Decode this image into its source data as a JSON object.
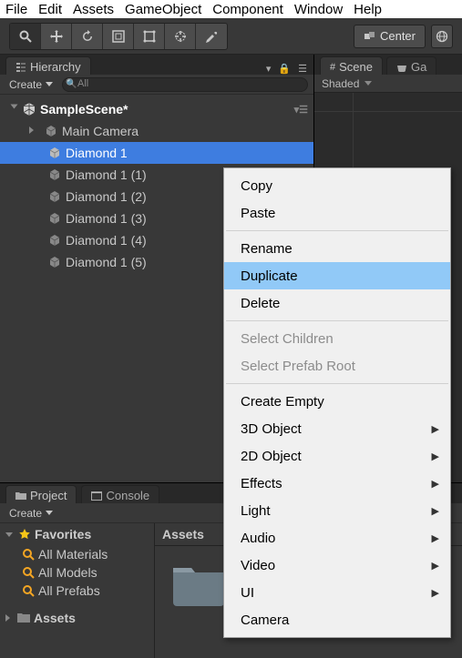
{
  "menubar": [
    "File",
    "Edit",
    "Assets",
    "GameObject",
    "Component",
    "Window",
    "Help"
  ],
  "toolbar": {
    "center": "Center"
  },
  "hierarchy": {
    "tab_label": "Hierarchy",
    "create": "Create",
    "search_placeholder": "All",
    "scene_name": "SampleScene*",
    "items": [
      {
        "label": "Main Camera",
        "arrow": true
      },
      {
        "label": "Diamond 1",
        "selected": true
      },
      {
        "label": "Diamond 1 (1)"
      },
      {
        "label": "Diamond 1 (2)"
      },
      {
        "label": "Diamond 1 (3)"
      },
      {
        "label": "Diamond 1 (4)"
      },
      {
        "label": "Diamond 1 (5)"
      }
    ]
  },
  "scene": {
    "tab_label": "Scene",
    "game_tab": "Ga",
    "shaded": "Shaded"
  },
  "project": {
    "project_tab": "Project",
    "console_tab": "Console",
    "create": "Create",
    "favorites_header": "Favorites",
    "fav_items": [
      "All Materials",
      "All Models",
      "All Prefabs"
    ],
    "assets_header_crumb": "Assets",
    "assets_section": "Assets"
  },
  "context_menu": {
    "items": [
      {
        "label": "Copy"
      },
      {
        "label": "Paste"
      },
      {
        "sep": true
      },
      {
        "label": "Rename"
      },
      {
        "label": "Duplicate",
        "highlight": true
      },
      {
        "label": "Delete"
      },
      {
        "sep": true
      },
      {
        "label": "Select Children",
        "disabled": true
      },
      {
        "label": "Select Prefab Root",
        "disabled": true
      },
      {
        "sep": true
      },
      {
        "label": "Create Empty"
      },
      {
        "label": "3D Object",
        "submenu": true
      },
      {
        "label": "2D Object",
        "submenu": true
      },
      {
        "label": "Effects",
        "submenu": true
      },
      {
        "label": "Light",
        "submenu": true
      },
      {
        "label": "Audio",
        "submenu": true
      },
      {
        "label": "Video",
        "submenu": true
      },
      {
        "label": "UI",
        "submenu": true
      },
      {
        "label": "Camera"
      }
    ]
  }
}
